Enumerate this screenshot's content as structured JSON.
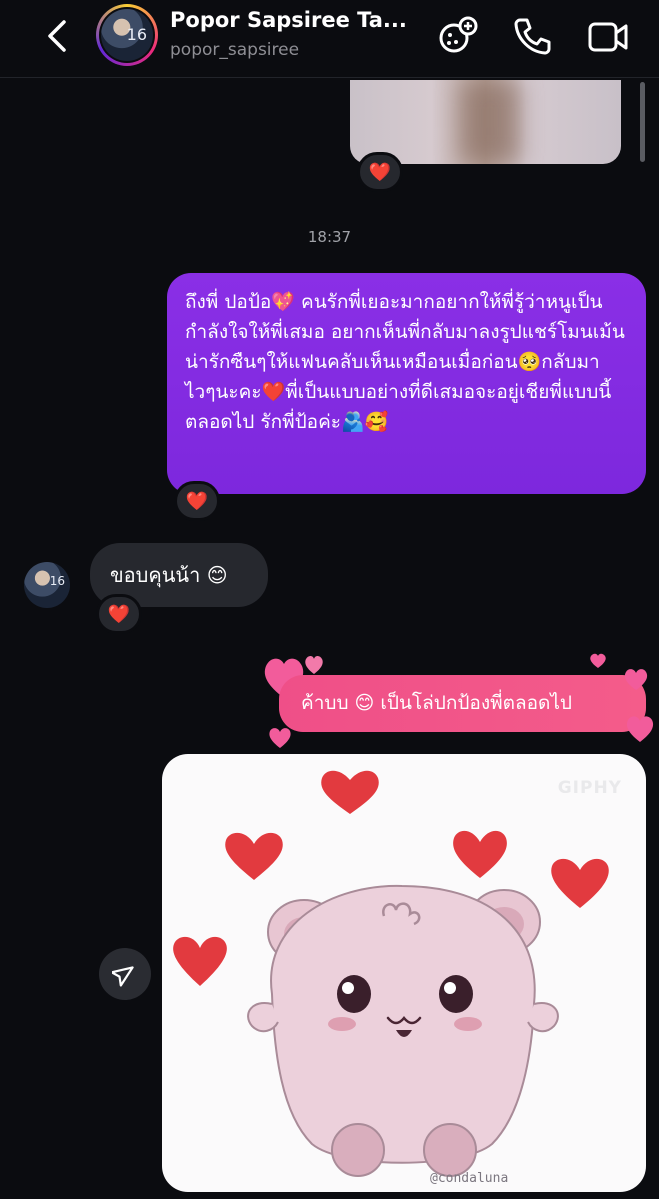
{
  "header": {
    "name": "Popor Sapsiree Ta...",
    "username": "popor_sapsiree",
    "avatar_badge": "16"
  },
  "messages": {
    "reaction": "❤️",
    "timestamp": "18:37",
    "sent_long": "ถึงพี่ ปอป้อ💖  คนรักพี่เยอะมากอยากให้พี่รู้ว่าหนูเป็นกำลังใจให้พี่เสมอ อยากเห็นพี่กลับมาลงรูปแชร์โมนเม้นน่ารักซืนๆให้แฟนคลับเห็นเหมือนเมื่อก่อน🥺กลับมาไวๆนะคะ❤️พี่เป็นแบบอย่างที่ดีเสมอจะอยู่เชียพี่แบบนี้ตลอดไป รักพี่ป้อค่ะ🫂🥰",
    "received": "ขอบคุนน้า 😊",
    "sent_pink": "ค้าบบ 😊 เป็นโล่ปกป้องพี่ตลอดไป",
    "sticker_watermark": "GIPHY",
    "sticker_credit": "@condaluna"
  },
  "colors": {
    "background": "#0b0c10",
    "sent_bubble": "#8a2be2",
    "received_bubble": "#26282e",
    "pink_bubble": "#ef4f88",
    "heart": "#e0262f"
  },
  "icons": [
    "back-chevron-icon",
    "video-effects-icon",
    "phone-icon",
    "video-call-icon",
    "heart-reaction-icon",
    "share-send-icon"
  ]
}
